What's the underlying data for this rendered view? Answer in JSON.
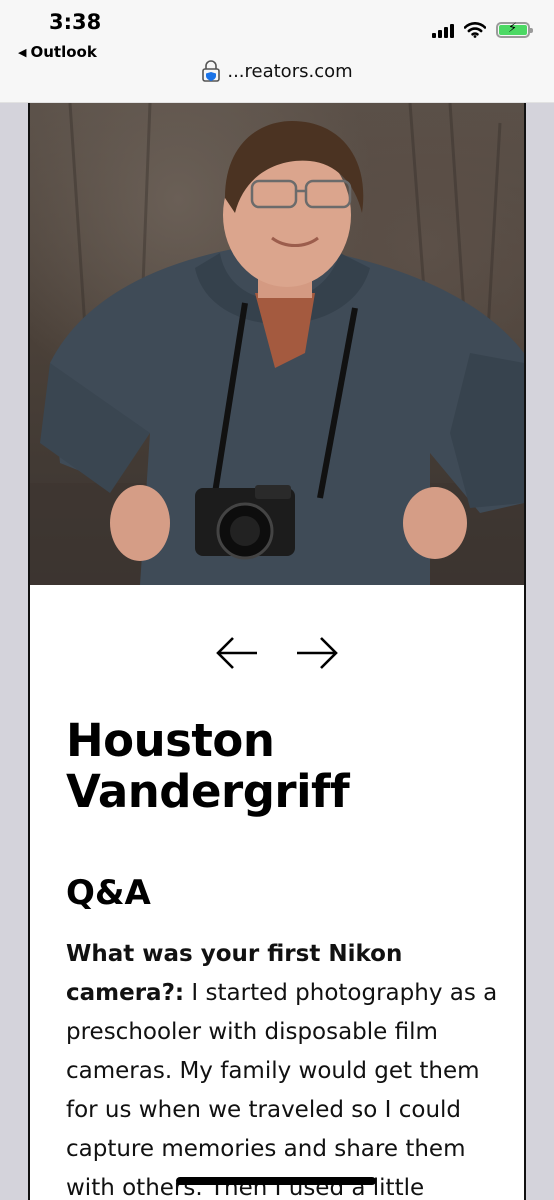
{
  "status_bar": {
    "time": "3:38",
    "back_app": "Outlook",
    "url": "...reators.com"
  },
  "profile": {
    "first_name": "Houston",
    "last_name": "Vandergriff",
    "photo_alt": "Portrait of Houston Vandergriff with a Nikon camera"
  },
  "carousel": {
    "prev_label": "←",
    "next_label": "→"
  },
  "qa": {
    "heading": "Q&A",
    "question": "What was your first Nikon camera?:",
    "answer": " I started photography as a preschooler with disposable film cameras. My family would get them for us when we traveled so I could capture memories and share them with others. Then I used a little"
  },
  "colors": {
    "status_bg": "#f7f7f7",
    "page_bg": "#ffffff",
    "side_bg": "#d4d3db",
    "battery_green": "#4cd964",
    "text": "#000000"
  }
}
